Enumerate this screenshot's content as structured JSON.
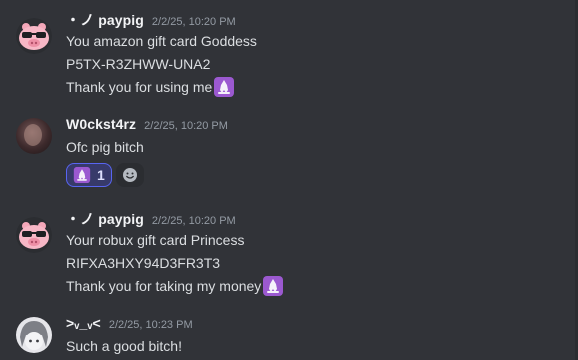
{
  "messages": [
    {
      "author": "・ノ paypig",
      "timestamp": "2/2/25, 10:20 PM",
      "avatar_icon": "pig-with-sunglasses-icon",
      "lines": [
        "You amazon gift card Goddess",
        "P5TX-R3ZHWW-UNA2",
        "Thank you for using me"
      ],
      "trailing_emoji": "pray-emoji-icon"
    },
    {
      "author": "W0ckst4rz",
      "timestamp": "2/2/25, 10:20 PM",
      "avatar_icon": "user-photo-avatar",
      "lines": [
        "Ofc pig bitch"
      ],
      "reaction": {
        "emoji": "pray-emoji-icon",
        "count": "1"
      }
    },
    {
      "author": "・ノ paypig",
      "timestamp": "2/2/25, 10:20 PM",
      "avatar_icon": "pig-with-sunglasses-icon",
      "lines": [
        "Your robux gift card Princess",
        "RIFXA3HXY94D3FR3T3",
        "Thank you for taking my money"
      ],
      "trailing_emoji": "pray-emoji-icon"
    },
    {
      "author": ">ᵥ_ᵥ<",
      "timestamp": "2/2/25, 10:23 PM",
      "avatar_icon": "anime-avatar",
      "lines": [
        "Such a good bitch!"
      ]
    }
  ],
  "colors": {
    "background": "#313338",
    "reaction_bg": "#373a6a",
    "reaction_border": "#5865f2",
    "emoji_purple": "#9b59d0"
  }
}
